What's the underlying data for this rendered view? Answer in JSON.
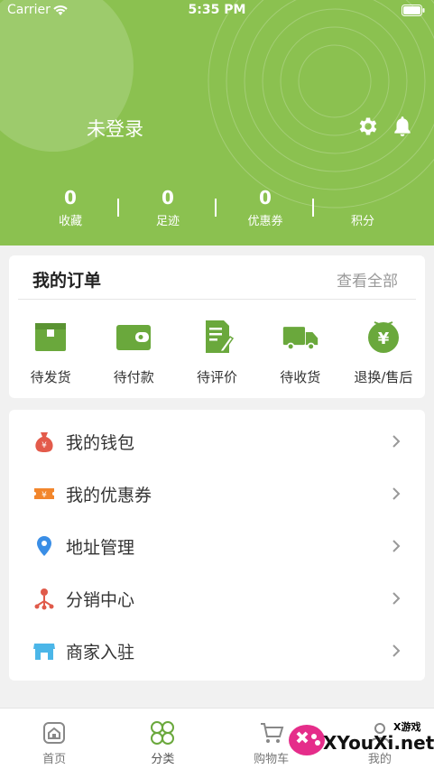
{
  "status_bar": {
    "carrier": "Carrier",
    "time": "5:35 PM"
  },
  "header": {
    "username": "未登录",
    "stats": [
      {
        "value": "0",
        "label": "收藏"
      },
      {
        "value": "0",
        "label": "足迹"
      },
      {
        "value": "0",
        "label": "优惠券"
      },
      {
        "value": "",
        "label": "积分"
      }
    ]
  },
  "orders": {
    "title": "我的订单",
    "view_all": "查看全部",
    "items": [
      {
        "label": "待发货",
        "icon": "box-icon"
      },
      {
        "label": "待付款",
        "icon": "wallet-icon"
      },
      {
        "label": "待评价",
        "icon": "review-icon"
      },
      {
        "label": "待收货",
        "icon": "truck-icon"
      },
      {
        "label": "退换/售后",
        "icon": "refund-icon"
      }
    ]
  },
  "menu": {
    "items": [
      {
        "label": "我的钱包",
        "icon": "money-bag-icon",
        "color": "#e35b4b"
      },
      {
        "label": "我的优惠券",
        "icon": "coupon-icon",
        "color": "#f2862c"
      },
      {
        "label": "地址管理",
        "icon": "location-pin-icon",
        "color": "#3a8ee6"
      },
      {
        "label": "分销中心",
        "icon": "distribution-icon",
        "color": "#e05a4a"
      },
      {
        "label": "商家入驻",
        "icon": "store-icon",
        "color": "#4bb6e8"
      }
    ]
  },
  "tabbar": {
    "items": [
      {
        "label": "首页",
        "icon": "home-icon"
      },
      {
        "label": "分类",
        "icon": "category-icon"
      },
      {
        "label": "购物车",
        "icon": "cart-icon"
      },
      {
        "label": "我的",
        "icon": "user-icon"
      }
    ]
  },
  "watermark": {
    "small": "X游戏",
    "big": "XYouXi.net"
  },
  "colors": {
    "accent": "#8bc150",
    "icon_green": "#6aa83c",
    "background": "#f1f1f1"
  }
}
